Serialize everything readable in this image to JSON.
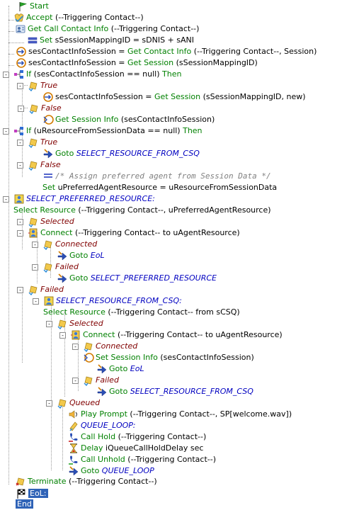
{
  "rows": [
    {
      "name": "step-start",
      "icon": "flag-green-icon",
      "parts": [
        [
          "Start",
          "kw"
        ]
      ]
    },
    {
      "name": "step-accept",
      "icon": "accept-icon",
      "parts": [
        [
          "Accept",
          "kw"
        ],
        [
          " (--Triggering Contact--)",
          "blk"
        ]
      ]
    },
    {
      "name": "step-get-call-contact-info",
      "icon": "contact-info-icon",
      "parts": [
        [
          "Get Call Contact Info",
          "kw"
        ],
        [
          " (--Triggering Contact--)",
          "blk"
        ]
      ]
    },
    {
      "name": "step-set-session-mapping-id",
      "icon": "set-icon",
      "parts": [
        [
          "Set",
          "kw"
        ],
        [
          " sSessionMappingID = sDNIS + sANI",
          "blk"
        ]
      ]
    },
    {
      "name": "step-ses-contact-info-get-contact-info",
      "icon": "session-get-icon",
      "parts": [
        [
          "sesContactInfoSession = ",
          "blk"
        ],
        [
          "Get Contact Info",
          "kw"
        ],
        [
          " (--Triggering Contact--, Session)",
          "blk"
        ]
      ]
    },
    {
      "name": "step-ses-contact-info-get-session",
      "icon": "session-get-icon",
      "parts": [
        [
          "sesContactInfoSession = ",
          "blk"
        ],
        [
          "Get Session",
          "kw"
        ],
        [
          " (sSessionMappingID)",
          "blk"
        ]
      ]
    },
    {
      "name": "step-if-session-null",
      "icon": "if-icon",
      "expander": "-",
      "parts": [
        [
          "If",
          "kw"
        ],
        [
          " (sesContactInfoSession == null) ",
          "blk"
        ],
        [
          "Then",
          "kw"
        ]
      ]
    },
    {
      "name": "branch-true-1",
      "icon": "branch-icon",
      "expander": "-",
      "parts": [
        [
          "True",
          "it"
        ]
      ]
    },
    {
      "name": "step-get-session-new",
      "icon": "session-get-icon",
      "parts": [
        [
          "sesContactInfoSession = ",
          "blk"
        ],
        [
          "Get Session",
          "kw"
        ],
        [
          " (sSessionMappingID, new)",
          "blk"
        ]
      ]
    },
    {
      "name": "branch-false-1",
      "icon": "branch-icon",
      "expander": "-",
      "parts": [
        [
          "False",
          "it"
        ]
      ]
    },
    {
      "name": "step-get-session-info-1",
      "icon": "session-info-icon",
      "parts": [
        [
          "Get Session Info",
          "kw"
        ],
        [
          " (sesContactInfoSession)",
          "blk"
        ]
      ]
    },
    {
      "name": "step-if-resource-null",
      "icon": "if-icon",
      "expander": "-",
      "parts": [
        [
          "If",
          "kw"
        ],
        [
          " (uResourceFromSessionData == null) ",
          "blk"
        ],
        [
          "Then",
          "kw"
        ]
      ]
    },
    {
      "name": "branch-true-2",
      "icon": "branch-icon",
      "expander": "-",
      "parts": [
        [
          "True",
          "it"
        ]
      ]
    },
    {
      "name": "step-goto-select-resource-csq",
      "icon": "goto-icon",
      "parts": [
        [
          "Goto ",
          "kw"
        ],
        [
          "SELECT_RESOURCE_FROM_CSQ",
          "lbl"
        ]
      ]
    },
    {
      "name": "branch-false-2",
      "icon": "branch-icon",
      "expander": "-",
      "parts": [
        [
          "False",
          "it"
        ]
      ]
    },
    {
      "name": "step-comment-assign-agent",
      "icon": "comment-icon",
      "parts": [
        [
          "/* Assign preferred agent from Session Data */",
          "cmt"
        ]
      ]
    },
    {
      "name": "step-set-preferred-agent",
      "icon": "none",
      "parts": [
        [
          "Set",
          "kw"
        ],
        [
          " uPreferredAgentResource = uResourceFromSessionData",
          "blk"
        ]
      ]
    },
    {
      "name": "label-select-preferred-resource",
      "icon": "label-icon",
      "expander": "-",
      "parts": [
        [
          "SELECT_PREFERRED_RESOURCE:",
          "lbl"
        ]
      ]
    },
    {
      "name": "step-select-resource-preferred",
      "icon": "none",
      "parts": [
        [
          "Select Resource",
          "kw"
        ],
        [
          " (--Triggering Contact--, uPreferredAgentResource)",
          "blk"
        ]
      ]
    },
    {
      "name": "branch-selected-1",
      "icon": "branch-icon",
      "expander": "-",
      "parts": [
        [
          "Selected",
          "it"
        ]
      ]
    },
    {
      "name": "step-connect-1",
      "icon": "connect-icon",
      "expander": "-",
      "parts": [
        [
          "Connect",
          "kw"
        ],
        [
          " (--Triggering Contact-- to uAgentResource)",
          "blk"
        ]
      ]
    },
    {
      "name": "branch-connected-1",
      "icon": "branch-icon",
      "expander": "-",
      "parts": [
        [
          "Connected",
          "it"
        ]
      ]
    },
    {
      "name": "step-goto-eol-1",
      "icon": "goto-icon",
      "parts": [
        [
          "Goto ",
          "kw"
        ],
        [
          "EoL",
          "lbl"
        ]
      ]
    },
    {
      "name": "branch-failed-1",
      "icon": "branch-icon",
      "expander": "-",
      "parts": [
        [
          "Failed",
          "it"
        ]
      ]
    },
    {
      "name": "step-goto-select-preferred",
      "icon": "goto-icon",
      "parts": [
        [
          "Goto ",
          "kw"
        ],
        [
          "SELECT_PREFERRED_RESOURCE",
          "lbl"
        ]
      ]
    },
    {
      "name": "branch-failed-2",
      "icon": "branch-icon",
      "expander": "-",
      "parts": [
        [
          "Failed",
          "it"
        ]
      ]
    },
    {
      "name": "label-select-resource-csq",
      "icon": "label-icon",
      "expander": "-",
      "parts": [
        [
          "SELECT_RESOURCE_FROM_CSQ:",
          "lbl"
        ]
      ]
    },
    {
      "name": "step-select-resource-csq",
      "icon": "none",
      "parts": [
        [
          "Select Resource",
          "kw"
        ],
        [
          " (--Triggering Contact-- from sCSQ)",
          "blk"
        ]
      ]
    },
    {
      "name": "branch-selected-2",
      "icon": "branch-icon",
      "expander": "-",
      "parts": [
        [
          "Selected",
          "it"
        ]
      ]
    },
    {
      "name": "step-connect-2",
      "icon": "connect-icon",
      "expander": "-",
      "parts": [
        [
          "Connect",
          "kw"
        ],
        [
          " (--Triggering Contact-- to uAgentResource)",
          "blk"
        ]
      ]
    },
    {
      "name": "branch-connected-2",
      "icon": "branch-icon",
      "expander": "-",
      "parts": [
        [
          "Connected",
          "it"
        ]
      ]
    },
    {
      "name": "step-set-session-info-2",
      "icon": "session-info-icon",
      "parts": [
        [
          "Set Session Info",
          "kw"
        ],
        [
          " (sesContactInfoSession)",
          "blk"
        ]
      ]
    },
    {
      "name": "step-goto-eol-2",
      "icon": "goto-icon",
      "parts": [
        [
          "Goto ",
          "kw"
        ],
        [
          "EoL",
          "lbl"
        ]
      ]
    },
    {
      "name": "branch-failed-3",
      "icon": "branch-icon",
      "expander": "-",
      "parts": [
        [
          "Failed",
          "it"
        ]
      ]
    },
    {
      "name": "step-goto-select-resource-csq-2",
      "icon": "goto-icon",
      "parts": [
        [
          "Goto ",
          "kw"
        ],
        [
          "SELECT_RESOURCE_FROM_CSQ",
          "lbl"
        ]
      ]
    },
    {
      "name": "branch-queued",
      "icon": "branch-icon",
      "expander": "-",
      "parts": [
        [
          "Queued",
          "it"
        ]
      ]
    },
    {
      "name": "step-play-prompt",
      "icon": "speaker-icon",
      "parts": [
        [
          "Play Prompt",
          "kw"
        ],
        [
          " (--Triggering Contact--, SP[welcome.wav])",
          "blk"
        ]
      ]
    },
    {
      "name": "label-queue-loop",
      "icon": "label-small-icon",
      "parts": [
        [
          "QUEUE_LOOP:",
          "lbl"
        ]
      ]
    },
    {
      "name": "step-call-hold",
      "icon": "call-hold-icon",
      "parts": [
        [
          "Call Hold",
          "kw"
        ],
        [
          " (--Triggering Contact--)",
          "blk"
        ]
      ]
    },
    {
      "name": "step-delay",
      "icon": "hourglass-icon",
      "parts": [
        [
          "Delay",
          "kw"
        ],
        [
          " iQueueCallHoldDelay sec",
          "blk"
        ]
      ]
    },
    {
      "name": "step-call-unhold",
      "icon": "call-unhold-icon",
      "parts": [
        [
          "Call Unhold",
          "kw"
        ],
        [
          " (--Triggering Contact--)",
          "blk"
        ]
      ]
    },
    {
      "name": "step-goto-queue-loop",
      "icon": "goto-icon",
      "parts": [
        [
          "Goto ",
          "kw"
        ],
        [
          "QUEUE_LOOP",
          "lbl"
        ]
      ]
    },
    {
      "name": "step-terminate",
      "icon": "terminate-icon",
      "parts": [
        [
          "Terminate",
          "kw"
        ],
        [
          " (--Triggering Contact--)",
          "blk"
        ]
      ]
    },
    {
      "name": "label-eol",
      "icon": "checkered-flag-icon",
      "parts": [
        [
          "EoL:",
          "sel"
        ]
      ]
    },
    {
      "name": "step-end",
      "icon": "none",
      "parts": [
        [
          "End",
          "sel"
        ]
      ]
    }
  ],
  "colors": {
    "keyword": "#008000",
    "branch": "#800000",
    "label": "#0000c0",
    "comment": "#808080",
    "selection": "#2f63b7"
  }
}
